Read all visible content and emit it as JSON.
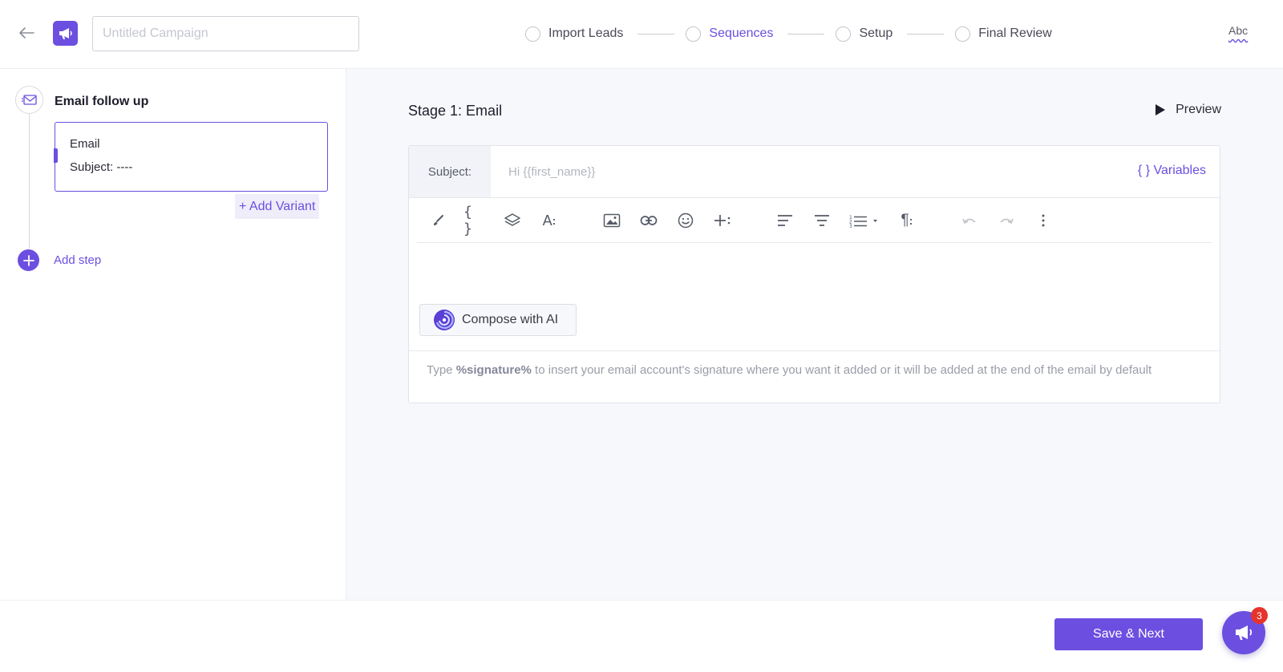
{
  "header": {
    "campaign_name_value": "",
    "campaign_name_placeholder": "Untitled Campaign",
    "steps": [
      {
        "label": "Import Leads",
        "active": false
      },
      {
        "label": "Sequences",
        "active": true
      },
      {
        "label": "Setup",
        "active": false
      },
      {
        "label": "Final Review",
        "active": false
      }
    ],
    "spellcheck_label": "Abc"
  },
  "sequence": {
    "title": "Email follow up",
    "card": {
      "type": "Email",
      "subject": "Subject: ----"
    },
    "add_variant_label": "+ Add Variant",
    "add_step_label": "Add step"
  },
  "editor": {
    "stage_title": "Stage 1: Email",
    "preview_label": "Preview",
    "subject_label": "Subject:",
    "subject_value": "",
    "subject_placeholder": "Hi {{first_name}}",
    "variables_label": "{ } Variables",
    "toolbar_icons": [
      "brush-icon",
      "code-braces-icon",
      "layers-icon",
      "text-size-icon",
      "image-icon",
      "link-icon",
      "emoji-icon",
      "insert-more-icon",
      "align-left-icon",
      "align-center-icon",
      "numbered-list-icon",
      "paragraph-icon",
      "undo-icon",
      "redo-icon",
      "more-vertical-icon"
    ],
    "compose_ai_label": "Compose with AI",
    "signature_hint_prefix": "Type ",
    "signature_hint_token": "%signature%",
    "signature_hint_suffix": " to insert your email account's signature where you want it added or it will be added at the end of the email by default"
  },
  "footer": {
    "save_next_label": "Save & Next",
    "notification_count": "3"
  },
  "colors": {
    "accent": "#6c4fe0",
    "badge": "#e5342b",
    "panel_bg": "#f7f8fc"
  }
}
